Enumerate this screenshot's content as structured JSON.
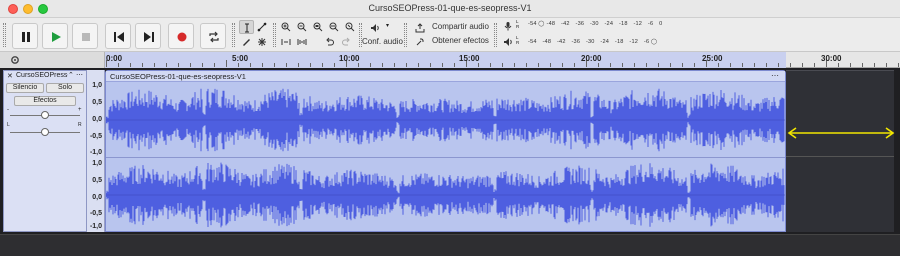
{
  "window": {
    "title": "CursoSEOPress-01-que-es-seopress-V1"
  },
  "toolbar": {
    "audio_setup_label": "Conf. audio",
    "share_audio_label": "Compartir audio",
    "get_effects_label": "Obtener efectos",
    "meter_scale": [
      "-54",
      "-48",
      "-42",
      "-36",
      "-30",
      "-24",
      "-18",
      "-12",
      "-6",
      "0"
    ],
    "meter_channel_left": "L",
    "meter_channel_right": "R",
    "accent_play": "#1f9e3e",
    "accent_record": "#d62a2a"
  },
  "ruler": {
    "labels": [
      "0:00",
      "5:00",
      "10:00",
      "15:00",
      "20:00",
      "25:00",
      "30:00"
    ]
  },
  "track": {
    "name": "CursoSEOPress-",
    "mute_label": "Silencio",
    "solo_label": "Solo",
    "effects_label": "Efectos",
    "gain_minus": "-",
    "gain_plus": "+",
    "pan_left": "L",
    "pan_right": "R",
    "scale_labels": [
      "1,0",
      "0,5",
      "0,0",
      "-0,5",
      "-1,0"
    ]
  },
  "clip": {
    "title": "CursoSEOPress-01-que-es-seopress-V1",
    "wave_color": "#4e5fe0",
    "bg_color": "#b9c5ee"
  },
  "annotation": {
    "arrow_color": "#f2e600"
  }
}
